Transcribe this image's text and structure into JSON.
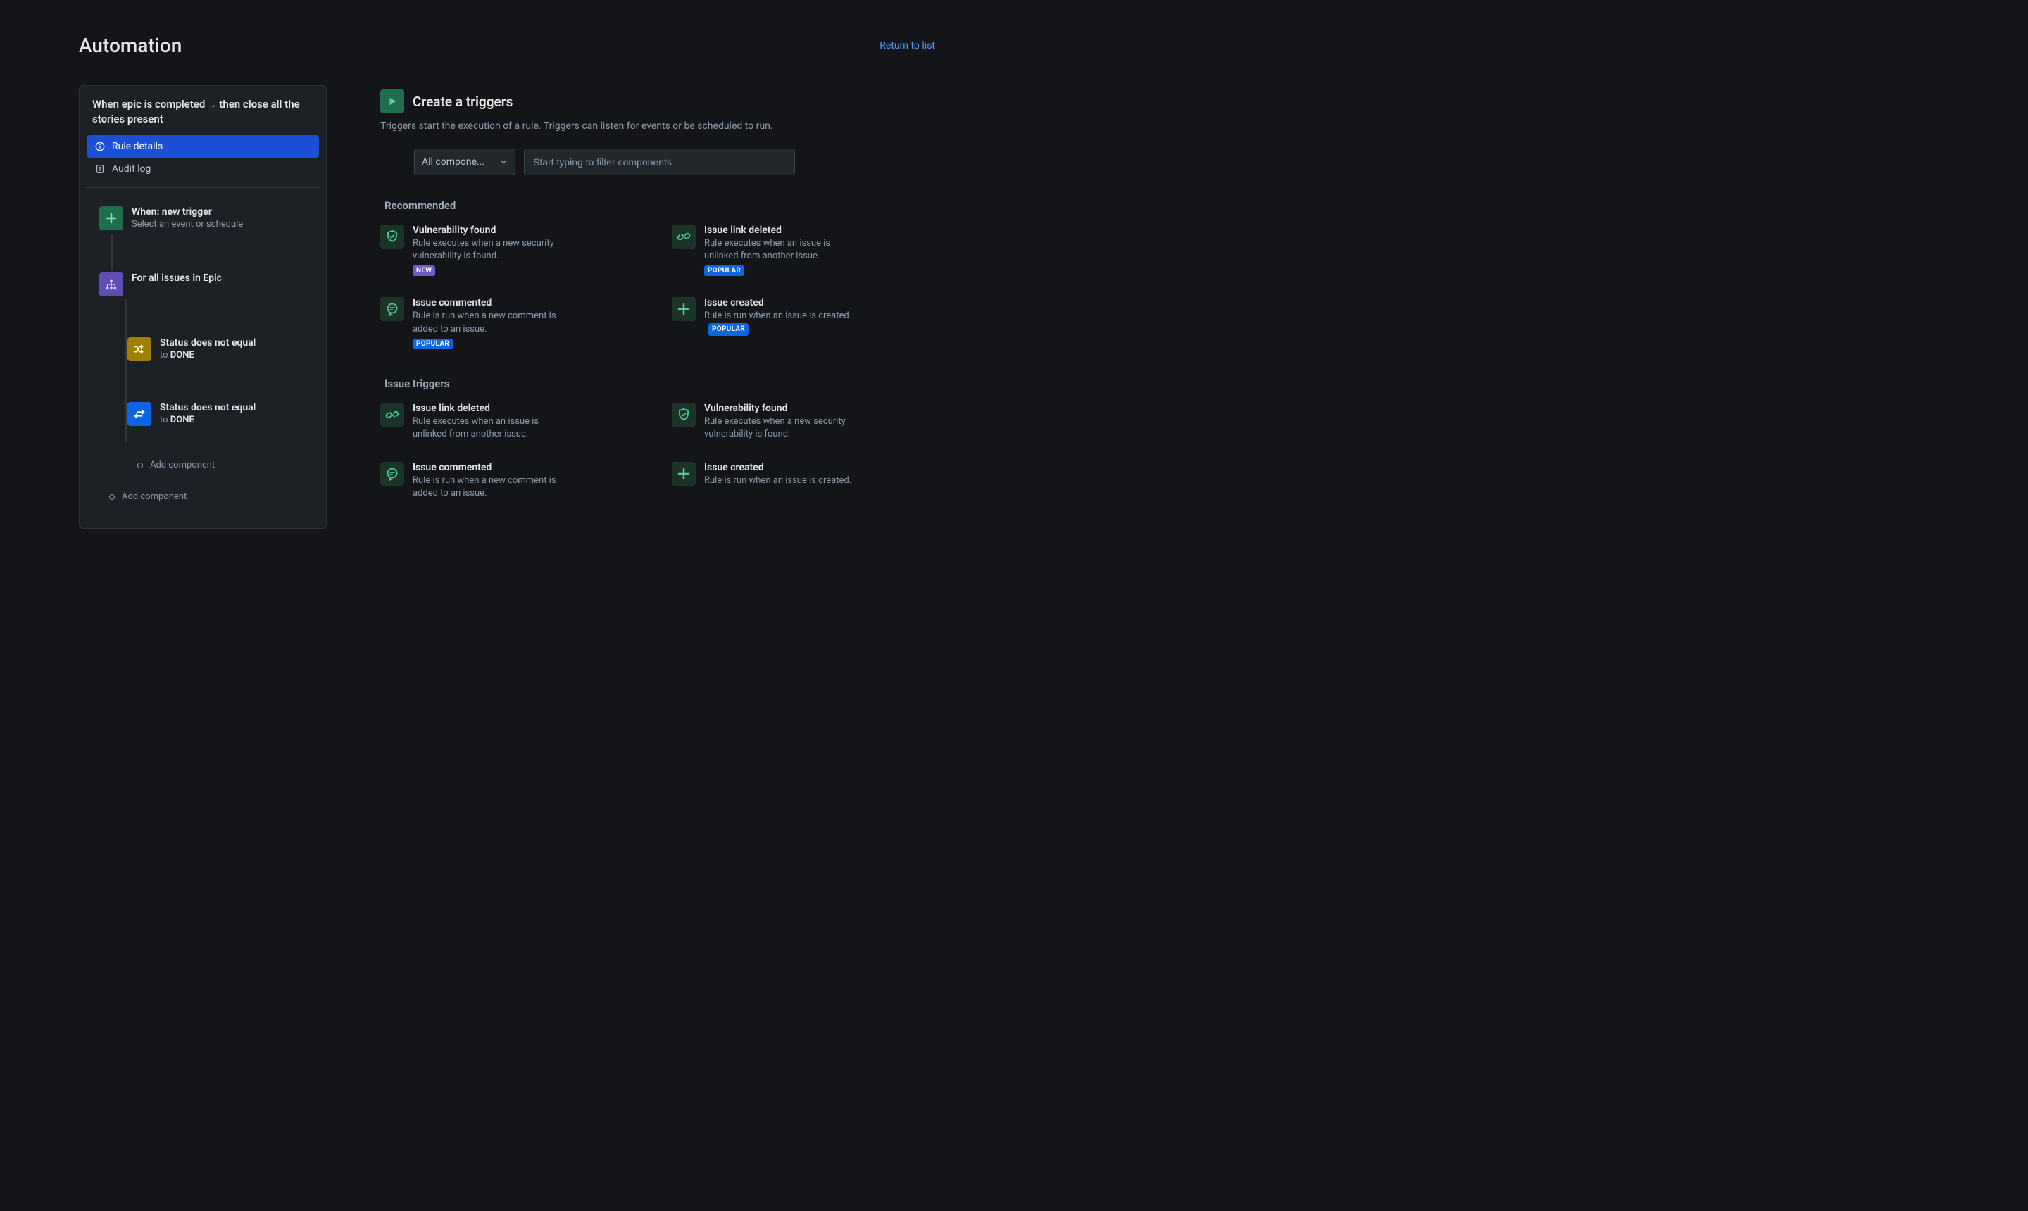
{
  "header": {
    "title": "Automation",
    "return_link": "Return to list"
  },
  "sidebar": {
    "rule_title_when": "When epic is completed",
    "rule_title_then": "then close all the stories present",
    "nav": {
      "rule_details": "Rule details",
      "audit_log": "Audit log"
    },
    "tree": {
      "trigger": {
        "title": "When: new trigger",
        "sub": "Select an event or schedule"
      },
      "branch": {
        "title": "For all issues in Epic"
      },
      "cond1": {
        "title": "Status does not equal",
        "sub_prefix": "to ",
        "sub_value": "DONE"
      },
      "cond2": {
        "title": "Status does not equal",
        "sub_prefix": "to ",
        "sub_value": "DONE"
      },
      "add_component": "Add component"
    }
  },
  "main": {
    "title": "Create a triggers",
    "subtitle": "Triggers start the execution of a rule. Triggers can listen for events or be scheduled to run.",
    "filter": {
      "select_label": "All compone...",
      "input_placeholder": "Start typing to filter components"
    },
    "sections": {
      "recommended": "Recommended",
      "issue_triggers": "Issue triggers"
    },
    "badges": {
      "new": "NEW",
      "popular": "POPULAR"
    },
    "triggers": {
      "vuln_found": {
        "title": "Vulnerability found",
        "desc": "Rule executes when a new security vulnerability is found."
      },
      "link_deleted": {
        "title": "Issue link deleted",
        "desc": "Rule executes when an issue is unlinked from another issue."
      },
      "commented": {
        "title": "Issue commented",
        "desc": "Rule is run when a new comment is added to an issue."
      },
      "created": {
        "title": "Issue created",
        "desc": "Rule is run when an issue is created."
      }
    }
  }
}
